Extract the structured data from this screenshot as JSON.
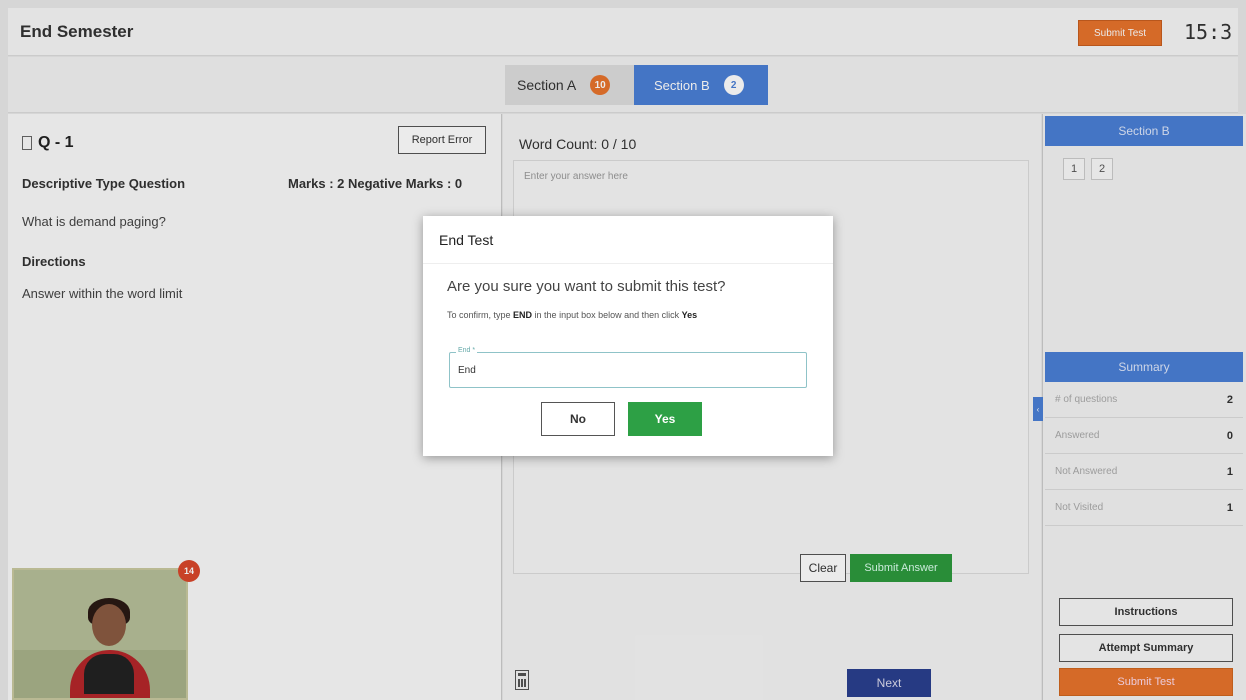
{
  "header": {
    "title": "End Semester",
    "submit_label": "Submit Test",
    "timer": "15:3"
  },
  "sections": [
    {
      "label": "Section A",
      "count": "10"
    },
    {
      "label": "Section B",
      "count": "2"
    }
  ],
  "question": {
    "number": "Q - 1",
    "report_label": "Report Error",
    "type": "Descriptive Type Question",
    "marks": "Marks : 2  Negative Marks : 0",
    "text": "What is demand paging?",
    "directions_heading": "Directions",
    "directions_text": "Answer within the word limit"
  },
  "webcam": {
    "badge": "14"
  },
  "answer": {
    "word_count": "Word Count: 0 / 10",
    "placeholder": "Enter your answer here",
    "clear_label": "Clear",
    "submit_label": "Submit Answer",
    "next_label": "Next"
  },
  "right_panel": {
    "section_title": "Section B",
    "question_numbers": [
      "1",
      "2"
    ],
    "summary_title": "Summary",
    "summary": [
      {
        "label": "# of questions",
        "value": "2"
      },
      {
        "label": "Answered",
        "value": "0"
      },
      {
        "label": "Not Answered",
        "value": "1"
      },
      {
        "label": "Not Visited",
        "value": "1"
      }
    ],
    "collapse_icon": "chevron-left-icon",
    "instructions_label": "Instructions",
    "attempt_summary_label": "Attempt Summary",
    "submit_label": "Submit Test"
  },
  "modal": {
    "title": "End Test",
    "question": "Are you sure you want to submit this test?",
    "hint_prefix": "To confirm, type ",
    "hint_keyword": "END",
    "hint_middle": " in the input box below and then click ",
    "hint_yes": "Yes",
    "input_label": "End *",
    "input_value": "End",
    "no_label": "No",
    "yes_label": "Yes"
  },
  "colors": {
    "accent_blue": "#4a7fd6",
    "submit_orange": "#e8732c",
    "confirm_green": "#2da045"
  }
}
